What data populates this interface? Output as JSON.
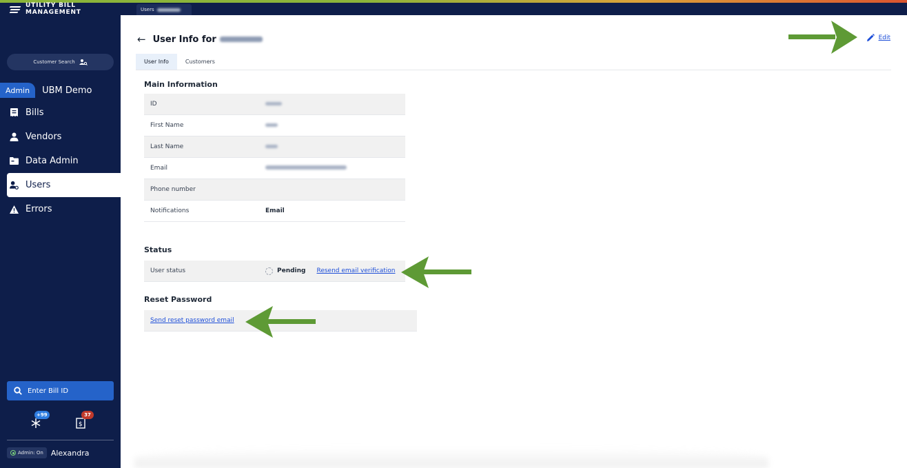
{
  "brand": {
    "name": "UTILITY BILL MANAGEMENT"
  },
  "topbar": {
    "crumb_label": "Users"
  },
  "sidebar": {
    "customer_search": "Customer Search",
    "tabs": {
      "admin": "Admin",
      "org": "UBM Demo"
    },
    "items": [
      {
        "label": "Bills",
        "icon": "bill-icon"
      },
      {
        "label": "Vendors",
        "icon": "person-icon"
      },
      {
        "label": "Data Admin",
        "icon": "folder-icon"
      },
      {
        "label": "Users",
        "icon": "user-gear-icon"
      },
      {
        "label": "Errors",
        "icon": "warning-icon"
      }
    ],
    "active_item": "Users",
    "bill_id_placeholder": "Enter Bill ID",
    "badges": {
      "alerts": "+99",
      "bills": "37"
    },
    "admin_status": "Admin: On",
    "user_name": "Alexandra"
  },
  "main": {
    "title_prefix": "User Info for",
    "edit_label": "Edit",
    "tabs": [
      "User Info",
      "Customers"
    ],
    "main_info": {
      "title": "Main Information",
      "rows": [
        {
          "label": "ID",
          "value": ""
        },
        {
          "label": "First Name",
          "value": ""
        },
        {
          "label": "Last Name",
          "value": ""
        },
        {
          "label": "Email",
          "value": ""
        },
        {
          "label": "Phone number",
          "value": ""
        },
        {
          "label": "Notifications",
          "value": "Email"
        }
      ]
    },
    "status": {
      "title": "Status",
      "label": "User status",
      "value": "Pending",
      "action": "Resend email verification"
    },
    "reset": {
      "title": "Reset Password",
      "action": "Send reset password email"
    }
  },
  "colors": {
    "sidebar_bg": "#0e1e4a",
    "accent_blue": "#2563c9",
    "link": "#1d4ed8",
    "arrow_green": "#5e9a35",
    "badge_blue": "#2f7de1",
    "badge_red": "#c0392b"
  }
}
